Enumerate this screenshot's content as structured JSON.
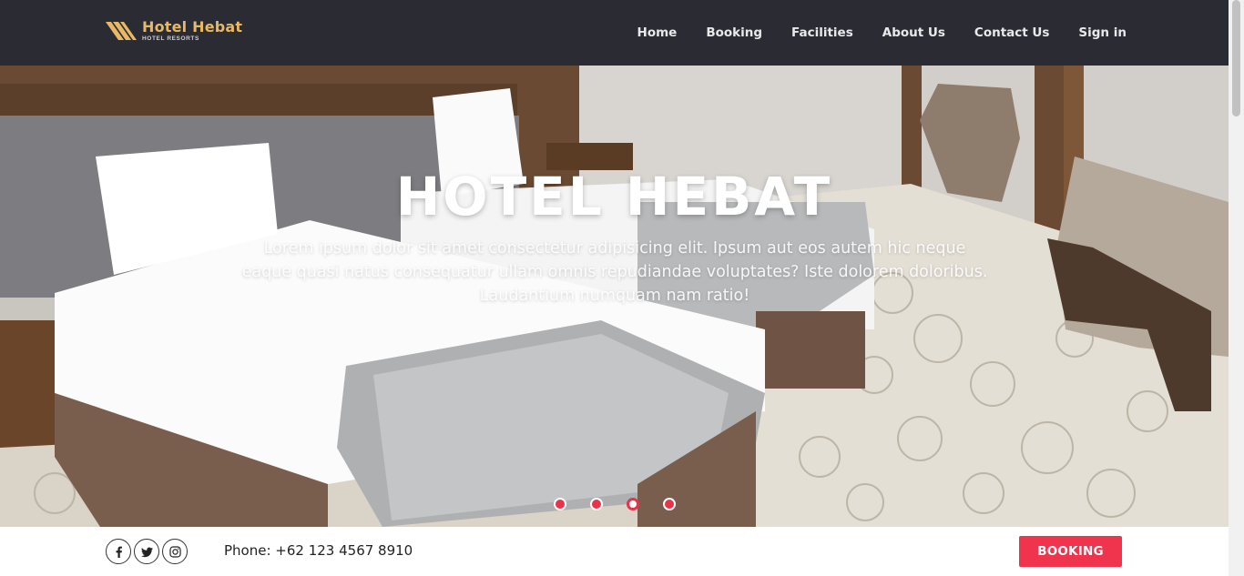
{
  "brand": {
    "name": "Hotel Hebat",
    "tagline": "HOTEL RESORTS"
  },
  "nav": {
    "items": [
      {
        "label": "Home"
      },
      {
        "label": "Booking"
      },
      {
        "label": "Facilities"
      },
      {
        "label": "About Us"
      },
      {
        "label": "Contact Us"
      },
      {
        "label": "Sign in"
      }
    ]
  },
  "hero": {
    "title": "HOTEL HEBAT",
    "description": "Lorem ipsum dolor sit amet consectetur adipisicing elit. Ipsum aut eos autem hic neque eaque quasi natus consequatur ullam omnis repudiandae voluptates? Iste dolorem doloribus. Laudantium numquam nam ratio!",
    "slides": 4,
    "active_slide": 3
  },
  "contact": {
    "phone": "Phone: +62 123 4567 8910",
    "socials": [
      "facebook-icon",
      "twitter-icon",
      "instagram-icon"
    ]
  },
  "cta": {
    "booking_label": "BOOKING"
  },
  "colors": {
    "navbar": "#2b2c33",
    "brand_gold": "#e7b865",
    "accent_red": "#f0344e"
  }
}
